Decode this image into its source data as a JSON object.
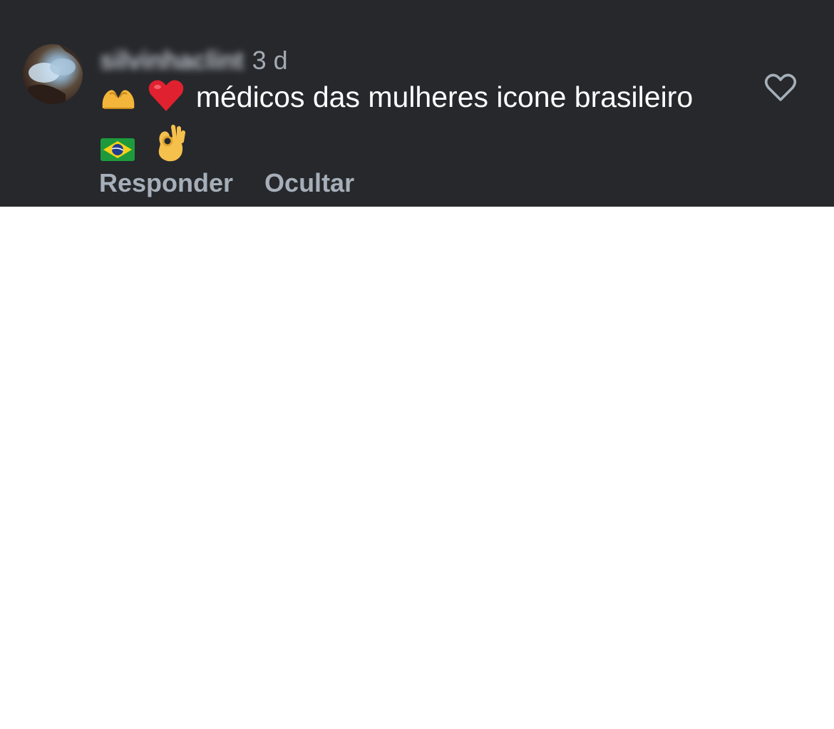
{
  "comment": {
    "username": "silvinhaclint",
    "time": "3 d",
    "text": "médicos das mulheres icone brasileiro",
    "emojis_before": [
      "heart-hands-icon",
      "red-heart-icon"
    ],
    "emojis_after": [
      "brazil-flag-icon",
      "ok-hand-icon"
    ],
    "actions": {
      "reply_label": "Responder",
      "hide_label": "Ocultar"
    },
    "like_icon": "heart-outline-icon"
  },
  "colors": {
    "panel_background": "#26282c",
    "page_background": "#ffffff",
    "text_primary": "#ffffff",
    "text_secondary": "#a6afb9"
  }
}
